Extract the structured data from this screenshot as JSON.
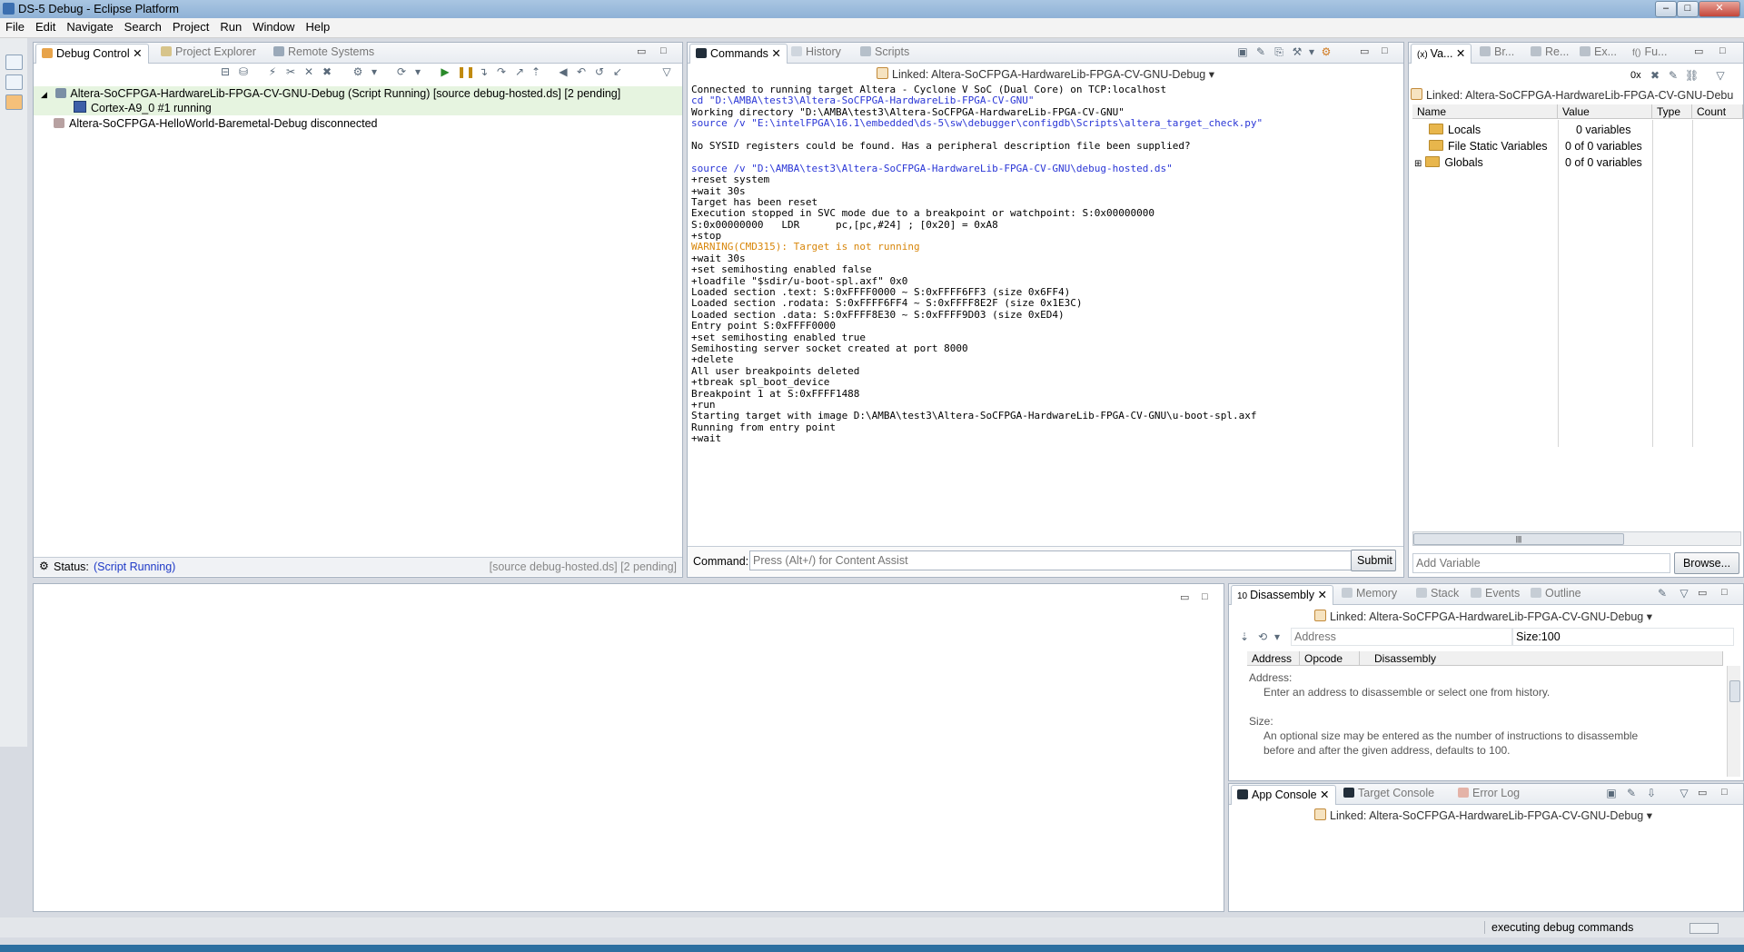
{
  "window": {
    "title": "DS-5 Debug - Eclipse Platform"
  },
  "menu": [
    "File",
    "Edit",
    "Navigate",
    "Search",
    "Project",
    "Run",
    "Window",
    "Help"
  ],
  "debug_panel": {
    "tabs": [
      "Debug Control",
      "Project Explorer",
      "Remote Systems"
    ],
    "items": [
      {
        "label": "Altera-SoCFPGA-HardwareLib-FPGA-CV-GNU-Debug (Script Running) [source debug-hosted.ds] [2 pending]"
      },
      {
        "label": "Cortex-A9_0 #1 running"
      },
      {
        "label": "Altera-SoCFPGA-HelloWorld-Baremetal-Debug disconnected"
      }
    ],
    "status_label": "Status:",
    "status_value": "(Script Running)",
    "status_right": "[source debug-hosted.ds] [2 pending]"
  },
  "commands_panel": {
    "tabs": [
      "Commands",
      "History",
      "Scripts"
    ],
    "linked": "Linked: Altera-SoCFPGA-HardwareLib-FPGA-CV-GNU-Debug",
    "lines": [
      {
        "t": "Connected to running target Altera - Cyclone V SoC (Dual Core) on TCP:localhost",
        "c": ""
      },
      {
        "t": "cd \"D:\\AMBA\\test3\\Altera-SoCFPGA-HardwareLib-FPGA-CV-GNU\"",
        "c": "blue"
      },
      {
        "t": "Working directory \"D:\\AMBA\\test3\\Altera-SoCFPGA-HardwareLib-FPGA-CV-GNU\"",
        "c": ""
      },
      {
        "t": "source /v \"E:\\intelFPGA\\16.1\\embedded\\ds-5\\sw\\debugger\\configdb\\Scripts\\altera_target_check.py\"",
        "c": "blue"
      },
      {
        "t": "",
        "c": ""
      },
      {
        "t": "No SYSID registers could be found. Has a peripheral description file been supplied?",
        "c": ""
      },
      {
        "t": "",
        "c": ""
      },
      {
        "t": "source /v \"D:\\AMBA\\test3\\Altera-SoCFPGA-HardwareLib-FPGA-CV-GNU\\debug-hosted.ds\"",
        "c": "blue"
      },
      {
        "t": "+reset system",
        "c": ""
      },
      {
        "t": "+wait 30s",
        "c": ""
      },
      {
        "t": "Target has been reset",
        "c": ""
      },
      {
        "t": "Execution stopped in SVC mode due to a breakpoint or watchpoint: S:0x00000000",
        "c": ""
      },
      {
        "t": "S:0x00000000   LDR      pc,[pc,#24] ; [0x20] = 0xA8",
        "c": ""
      },
      {
        "t": "+stop",
        "c": ""
      },
      {
        "t": "WARNING(CMD315): Target is not running",
        "c": "orange"
      },
      {
        "t": "+wait 30s",
        "c": ""
      },
      {
        "t": "+set semihosting enabled false",
        "c": ""
      },
      {
        "t": "+loadfile \"$sdir/u-boot-spl.axf\" 0x0",
        "c": ""
      },
      {
        "t": "Loaded section .text: S:0xFFFF0000 ~ S:0xFFFF6FF3 (size 0x6FF4)",
        "c": ""
      },
      {
        "t": "Loaded section .rodata: S:0xFFFF6FF4 ~ S:0xFFFF8E2F (size 0x1E3C)",
        "c": ""
      },
      {
        "t": "Loaded section .data: S:0xFFFF8E30 ~ S:0xFFFF9D03 (size 0xED4)",
        "c": ""
      },
      {
        "t": "Entry point S:0xFFFF0000",
        "c": ""
      },
      {
        "t": "+set semihosting enabled true",
        "c": ""
      },
      {
        "t": "Semihosting server socket created at port 8000",
        "c": ""
      },
      {
        "t": "+delete",
        "c": ""
      },
      {
        "t": "All user breakpoints deleted",
        "c": ""
      },
      {
        "t": "+tbreak spl_boot_device",
        "c": ""
      },
      {
        "t": "Breakpoint 1 at S:0xFFFF1488",
        "c": ""
      },
      {
        "t": "+run",
        "c": ""
      },
      {
        "t": "Starting target with image D:\\AMBA\\test3\\Altera-SoCFPGA-HardwareLib-FPGA-CV-GNU\\u-boot-spl.axf",
        "c": ""
      },
      {
        "t": "Running from entry point",
        "c": ""
      },
      {
        "t": "+wait",
        "c": ""
      }
    ],
    "command_label": "Command:",
    "command_placeholder": "Press (Alt+/) for Content Assist",
    "submit_label": "Submit"
  },
  "vars_panel": {
    "tabs": [
      "Va...",
      "Br...",
      "Re...",
      "Ex...",
      "Fu..."
    ],
    "radix": "0x",
    "linked": "Linked: Altera-SoCFPGA-HardwareLib-FPGA-CV-GNU-Debu",
    "headers": [
      "Name",
      "Value",
      "Type",
      "Count"
    ],
    "rows": [
      {
        "name": "Locals",
        "value": "0 variables"
      },
      {
        "name": "File Static Variables",
        "value": "0 of 0 variables"
      },
      {
        "name": "Globals",
        "value": "0 of 0 variables"
      }
    ],
    "add_variable": "Add Variable",
    "browse": "Browse..."
  },
  "disasm_panel": {
    "tabs": [
      "Disassembly",
      "Memory",
      "Stack",
      "Events",
      "Outline"
    ],
    "linked": "Linked: Altera-SoCFPGA-HardwareLib-FPGA-CV-GNU-Debug",
    "address_placeholder": "Address",
    "size_value": "Size:100",
    "headers": [
      "Address",
      "Opcode",
      "Disassembly"
    ],
    "help_address_title": "Address:",
    "help_address_text": "Enter an address to disassemble or select one from history.",
    "help_size_title": "Size:",
    "help_size_text1": "An optional size may be entered as the number of instructions to disassemble",
    "help_size_text2": "before and after the given address, defaults to 100."
  },
  "console_panel": {
    "tabs": [
      "App Console",
      "Target Console",
      "Error Log"
    ],
    "linked": "Linked: Altera-SoCFPGA-HardwareLib-FPGA-CV-GNU-Debug"
  },
  "status_bar": {
    "text": "executing debug commands"
  }
}
